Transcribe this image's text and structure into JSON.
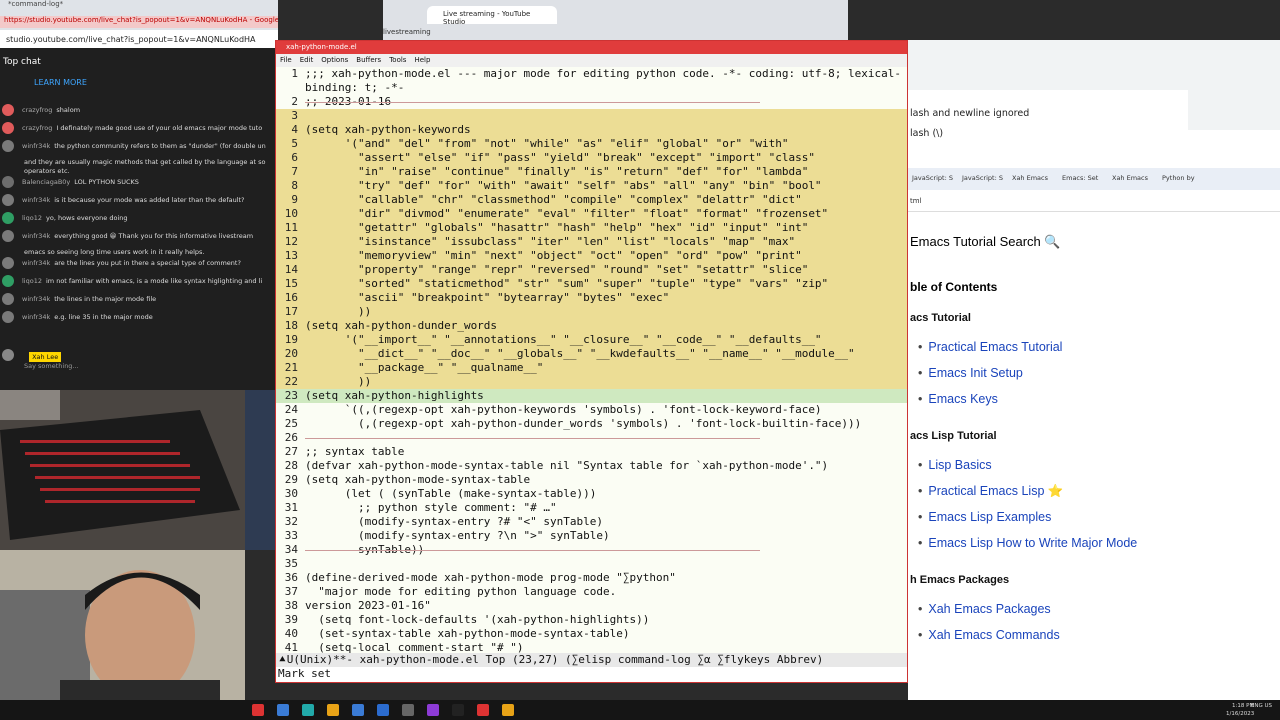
{
  "chat": {
    "window_tab": "*command-log*",
    "url_bar": "https://studio.youtube.com/live_chat?is_popout=1&v=ANQNLuKodHA - Google...",
    "url": "studio.youtube.com/live_chat?is_popout=1&v=ANQNLuKodHA",
    "header": "Top chat",
    "learn_more": "LEARN MORE",
    "messages": [
      {
        "author": "crazyfrog",
        "text": "shalom",
        "color": "#e05b5b"
      },
      {
        "author": "crazyfrog",
        "text": "I definately made good use of your old emacs major mode tuto",
        "color": "#e05b5b"
      },
      {
        "author": "winfr34k",
        "text": "the python community refers to them as \"dunder\" (for double un",
        "color": "#7a7a7a"
      },
      {
        "author": "",
        "text": "and they are usually magic methods that get called by the language at so",
        "color": ""
      },
      {
        "author": "",
        "text": "operators etc.",
        "color": ""
      },
      {
        "author": "BalenciagaB0y",
        "text": "LOL PYTHON SUCKS",
        "color": "#6d6d6d"
      },
      {
        "author": "winfr34k",
        "text": "is it because your mode was added later than the default?",
        "color": "#7a7a7a"
      },
      {
        "author": "liqo12",
        "text": "yo, hows everyone doing",
        "color": "#2f9e64"
      },
      {
        "author": "winfr34k",
        "text": "everything good 😀 Thank you for this informative livestream",
        "color": "#7a7a7a"
      },
      {
        "author": "",
        "text": "emacs so seeing long time users work in it really helps.",
        "color": ""
      },
      {
        "author": "winfr34k",
        "text": "are the lines you put in there a special type of comment?",
        "color": "#7a7a7a"
      },
      {
        "author": "liqo12",
        "text": "im not familiar with emacs, is a mode like syntax higlighting and li",
        "color": "#2f9e64"
      },
      {
        "author": "winfr34k",
        "text": "the lines in the major mode file",
        "color": "#7a7a7a"
      },
      {
        "author": "winfr34k",
        "text": "e.g. line 35 in the major mode",
        "color": "#7a7a7a"
      }
    ],
    "user_name": "Xah Lee",
    "input_placeholder": "Say something..."
  },
  "youtube_studio": {
    "tab_title": "Live streaming - YouTube Studio",
    "address": "livestreaming"
  },
  "emacs": {
    "title": "xah-python-mode.el",
    "menu": [
      "File",
      "Edit",
      "Options",
      "Buffers",
      "Tools",
      "Help"
    ],
    "lines": [
      {
        "n": "1",
        "text": ";;; xah-python-mode.el --- major mode for editing python code. -*- coding: utf-8; lexical-",
        "cls": ""
      },
      {
        "n": "",
        "text": "binding: t; -*-",
        "cls": ""
      },
      {
        "n": "2",
        "text": ";; 2023-01-16",
        "cls": ""
      },
      {
        "n": "3",
        "text": "",
        "cls": "hl"
      },
      {
        "n": "4",
        "text": "(setq xah-python-keywords",
        "cls": "hl"
      },
      {
        "n": "5",
        "text": "      '(\"and\" \"del\" \"from\" \"not\" \"while\" \"as\" \"elif\" \"global\" \"or\" \"with\"",
        "cls": "hl"
      },
      {
        "n": "6",
        "text": "        \"assert\" \"else\" \"if\" \"pass\" \"yield\" \"break\" \"except\" \"import\" \"class\"",
        "cls": "hl"
      },
      {
        "n": "7",
        "text": "        \"in\" \"raise\" \"continue\" \"finally\" \"is\" \"return\" \"def\" \"for\" \"lambda\"",
        "cls": "hl"
      },
      {
        "n": "8",
        "text": "        \"try\" \"def\" \"for\" \"with\" \"await\" \"self\" \"abs\" \"all\" \"any\" \"bin\" \"bool\"",
        "cls": "hl"
      },
      {
        "n": "9",
        "text": "        \"callable\" \"chr\" \"classmethod\" \"compile\" \"complex\" \"delattr\" \"dict\"",
        "cls": "hl"
      },
      {
        "n": "10",
        "text": "        \"dir\" \"divmod\" \"enumerate\" \"eval\" \"filter\" \"float\" \"format\" \"frozenset\"",
        "cls": "hl"
      },
      {
        "n": "11",
        "text": "        \"getattr\" \"globals\" \"hasattr\" \"hash\" \"help\" \"hex\" \"id\" \"input\" \"int\"",
        "cls": "hl"
      },
      {
        "n": "12",
        "text": "        \"isinstance\" \"issubclass\" \"iter\" \"len\" \"list\" \"locals\" \"map\" \"max\"",
        "cls": "hl"
      },
      {
        "n": "13",
        "text": "        \"memoryview\" \"min\" \"next\" \"object\" \"oct\" \"open\" \"ord\" \"pow\" \"print\"",
        "cls": "hl"
      },
      {
        "n": "14",
        "text": "        \"property\" \"range\" \"repr\" \"reversed\" \"round\" \"set\" \"setattr\" \"slice\"",
        "cls": "hl"
      },
      {
        "n": "15",
        "text": "        \"sorted\" \"staticmethod\" \"str\" \"sum\" \"super\" \"tuple\" \"type\" \"vars\" \"zip\"",
        "cls": "hl"
      },
      {
        "n": "16",
        "text": "        \"ascii\" \"breakpoint\" \"bytearray\" \"bytes\" \"exec\"",
        "cls": "hl"
      },
      {
        "n": "17",
        "text": "        ))",
        "cls": "hl"
      },
      {
        "n": "18",
        "text": "(setq xah-python-dunder_words",
        "cls": "hl"
      },
      {
        "n": "19",
        "text": "      '(\"__import__\" \"__annotations__\" \"__closure__\" \"__code__\" \"__defaults__\"",
        "cls": "hl"
      },
      {
        "n": "20",
        "text": "        \"__dict__\" \"__doc__\" \"__globals__\" \"__kwdefaults__\" \"__name__\" \"__module__\"",
        "cls": "hl"
      },
      {
        "n": "21",
        "text": "        \"__package__\" \"__qualname__\"",
        "cls": "hl"
      },
      {
        "n": "22",
        "text": "        ))",
        "cls": "hl"
      },
      {
        "n": "23",
        "text": "(setq xah-python-highlights",
        "cls": "hlg"
      },
      {
        "n": "24",
        "text": "      `((,(regexp-opt xah-python-keywords 'symbols) . 'font-lock-keyword-face)",
        "cls": ""
      },
      {
        "n": "25",
        "text": "        (,(regexp-opt xah-python-dunder_words 'symbols) . 'font-lock-builtin-face)))",
        "cls": ""
      },
      {
        "n": "26",
        "text": "",
        "cls": ""
      },
      {
        "n": "27",
        "text": ";; syntax table",
        "cls": ""
      },
      {
        "n": "28",
        "text": "(defvar xah-python-mode-syntax-table nil \"Syntax table for `xah-python-mode'.\")",
        "cls": ""
      },
      {
        "n": "29",
        "text": "(setq xah-python-mode-syntax-table",
        "cls": ""
      },
      {
        "n": "30",
        "text": "      (let ( (synTable (make-syntax-table)))",
        "cls": ""
      },
      {
        "n": "31",
        "text": "        ;; python style comment: \"# …\"",
        "cls": ""
      },
      {
        "n": "32",
        "text": "        (modify-syntax-entry ?# \"<\" synTable)",
        "cls": ""
      },
      {
        "n": "33",
        "text": "        (modify-syntax-entry ?\\n \">\" synTable)",
        "cls": ""
      },
      {
        "n": "34",
        "text": "        synTable))",
        "cls": ""
      },
      {
        "n": "35",
        "text": "",
        "cls": ""
      },
      {
        "n": "36",
        "text": "(define-derived-mode xah-python-mode prog-mode \"∑python\"",
        "cls": ""
      },
      {
        "n": "37",
        "text": "  \"major mode for editing python language code.",
        "cls": ""
      },
      {
        "n": "38",
        "text": "version 2023-01-16\"",
        "cls": ""
      },
      {
        "n": "39",
        "text": "  (setq font-lock-defaults '(xah-python-highlights))",
        "cls": ""
      },
      {
        "n": "40",
        "text": "  (set-syntax-table xah-python-mode-syntax-table)",
        "cls": ""
      },
      {
        "n": "41",
        "text": "  (setq-local comment-start \"# \")",
        "cls": ""
      }
    ],
    "mode_line": "⯅U(Unix)**- xah-python-mode.el Top (23,27) (∑elisp command-log ∑α ∑flykeys Abbrev)",
    "echo_area": "Mark set"
  },
  "right_browser": {
    "snippet_1": "lash and newline ignored",
    "snippet_2": "lash (\\)",
    "tabs": [
      "JavaScript: S",
      "JavaScript: S",
      "Xah Emacs",
      "Emacs: Set",
      "Xah Emacs",
      "Python by"
    ],
    "address": "tml",
    "page_title": "Emacs Tutorial Search 🔍",
    "toc_heading": "ble of Contents",
    "sections": [
      {
        "heading": "acs Tutorial",
        "links": [
          "Practical Emacs Tutorial",
          "Emacs Init Setup",
          "Emacs Keys"
        ]
      },
      {
        "heading": "acs Lisp Tutorial",
        "links": [
          "Lisp Basics",
          "Practical Emacs Lisp ⭐",
          "Emacs Lisp Examples",
          "Emacs Lisp How to Write Major Mode"
        ]
      },
      {
        "heading": "h Emacs Packages",
        "links": [
          "Xah Emacs Packages",
          "Xah Emacs Commands"
        ]
      }
    ]
  },
  "taskbar": {
    "time": "1:18 PM",
    "date": "1/16/2023",
    "lang": "ENG US"
  }
}
